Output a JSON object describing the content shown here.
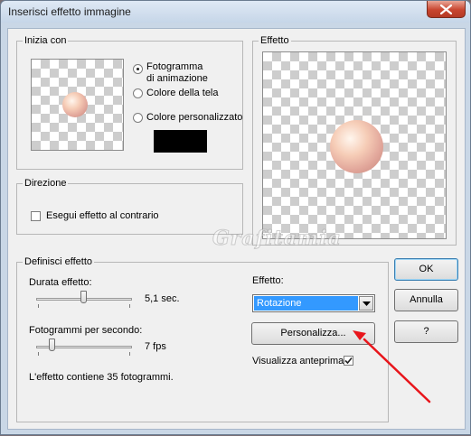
{
  "window": {
    "title": "Inserisci effetto immagine"
  },
  "inizia_con": {
    "label": "Inizia con",
    "options": [
      {
        "line1": "Fotogramma",
        "line2": "di animazione",
        "selected": true
      },
      {
        "line1": "Colore della tela",
        "selected": false
      },
      {
        "line1": "Colore personalizzato",
        "selected": false
      }
    ],
    "custom_color": "#000000"
  },
  "effetto_preview": {
    "label": "Effetto"
  },
  "direzione": {
    "label": "Direzione",
    "reverse_label": "Esegui effetto al contrario",
    "reverse_checked": false
  },
  "definisci": {
    "label": "Definisci effetto",
    "duration_label": "Durata effetto:",
    "duration_value": "5,1 sec.",
    "duration_level": 0.5,
    "fps_label": "Fotogrammi per secondo:",
    "fps_value": "7 fps",
    "fps_level": 0.22,
    "frames_text": "L'effetto contiene 35 fotogrammi.",
    "effect_label": "Effetto:",
    "effect_value": "Rotazione",
    "customize_button": "Personalizza...",
    "preview_label": "Visualizza anteprima",
    "preview_checked": true
  },
  "buttons": {
    "ok": "OK",
    "cancel": "Annulla",
    "help": "?"
  },
  "watermark": "Grafitamia",
  "colors": {
    "arrow": "#e8151b",
    "selection": "#3399ff"
  }
}
